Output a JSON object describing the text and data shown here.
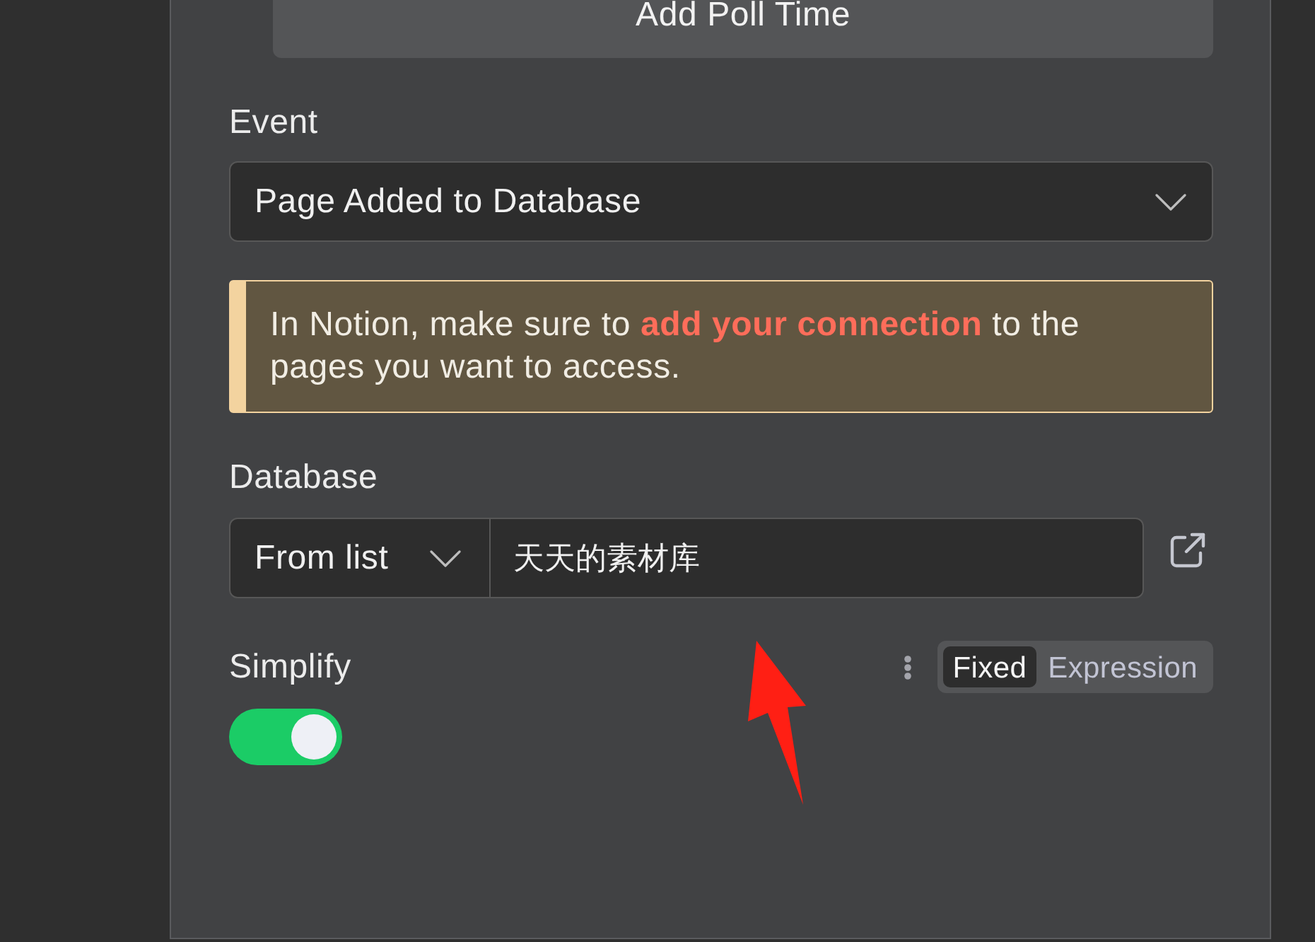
{
  "poll_button": {
    "label": "Add Poll Time"
  },
  "event": {
    "label": "Event",
    "value": "Page Added to Database"
  },
  "notice": {
    "parts": [
      {
        "kind": "text",
        "text": "In Notion, make sure to "
      },
      {
        "kind": "link",
        "text": "add your connection"
      },
      {
        "kind": "text",
        "text": " to the pages you want to access."
      }
    ]
  },
  "database": {
    "label": "Database",
    "mode": "From list",
    "value": "天天的素材库"
  },
  "simplify": {
    "label": "Simplify",
    "on": true,
    "mode_tabs": [
      {
        "label": "Fixed",
        "selected": true
      },
      {
        "label": "Expression",
        "selected": false
      }
    ]
  },
  "annotations": [
    {
      "kind": "arrow"
    }
  ]
}
